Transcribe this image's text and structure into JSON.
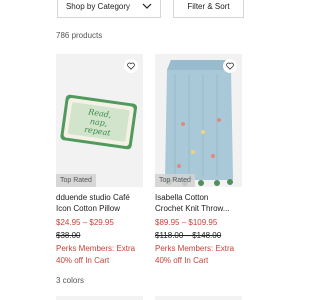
{
  "toolbar": {
    "sort_label": "Shop by Category",
    "filter_label": "Filter & Sort"
  },
  "results": {
    "count_text": "786 products"
  },
  "products": [
    {
      "badge": "Top Rated",
      "title_line1": "dduende studio Café",
      "title_line2": "Icon Cotton Pillow",
      "price": "$24.95 – $29.95",
      "original_price": "$38.00",
      "perks_line1": "Perks Members: Extra",
      "perks_line2": "40% off In Cart",
      "colors": "3 colors",
      "pillow_text_1": "Read,",
      "pillow_text_2": "nap,",
      "pillow_text_3": "repeat"
    },
    {
      "badge": "Top Rated",
      "title_line1": "Isabella Cotton",
      "title_line2": "Crochet Knit Throw...",
      "price": "$89.95 – $109.95",
      "original_price": "$118.00 – $148.00",
      "perks_line1": "Perks Members: Extra",
      "perks_line2": "40% off In Cart"
    }
  ],
  "colors": {
    "sale_red": "#c5443a",
    "pillow_green": "#4f9a5c",
    "throw_blue": "#a9c8d8"
  }
}
